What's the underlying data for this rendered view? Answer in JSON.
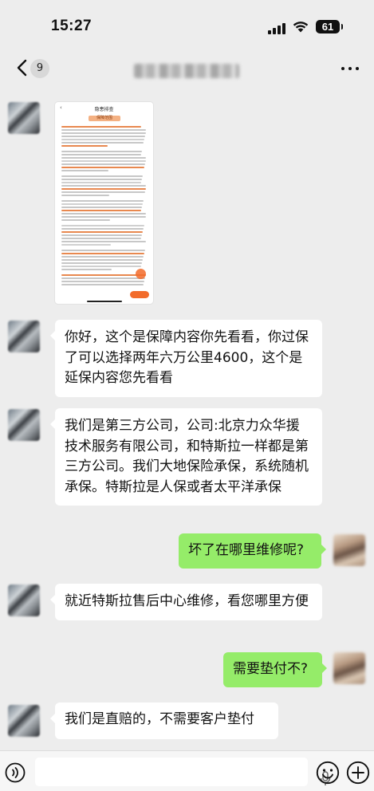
{
  "status_bar": {
    "time": "15:27",
    "battery": "61",
    "icons": [
      "signal-icon",
      "wifi-icon",
      "battery-icon"
    ]
  },
  "nav": {
    "back_icon": "chevron-left-icon",
    "unread_count": "9",
    "more_icon": "more-icon"
  },
  "messages": [
    {
      "side": "in",
      "type": "image",
      "image": {
        "header": "隐患排查",
        "tab": "保障范围"
      }
    },
    {
      "side": "in",
      "type": "text",
      "text": "你好，这个是保障内容你先看看，你过保了可以选择两年六万公里4600，这个是延保内容您先看看"
    },
    {
      "side": "in",
      "type": "text",
      "text": "我们是第三方公司，公司:北京力众华援技术服务有限公司，和特斯拉一样都是第三方公司。我们大地保险承保，系统随机承保。特斯拉是人保或者太平洋承保"
    },
    {
      "side": "out",
      "type": "text",
      "text": "坏了在哪里维修呢?"
    },
    {
      "side": "in",
      "type": "text",
      "text": "就近特斯拉售后中心维修，看您哪里方便"
    },
    {
      "side": "out",
      "type": "text",
      "text": "需要垫付不?"
    },
    {
      "side": "in",
      "type": "text",
      "text": "我们是直赔的，不需要客户垫付"
    }
  ],
  "input_bar": {
    "voice_icon": "voice-icon",
    "mic_icon": "microphone-icon",
    "emoji_icon": "emoji-icon",
    "plus_icon": "plus-icon"
  },
  "colors": {
    "background": "#ededed",
    "incoming_bubble": "#ffffff",
    "outgoing_bubble": "#95ec69",
    "image_accent": "#f26b2a"
  }
}
